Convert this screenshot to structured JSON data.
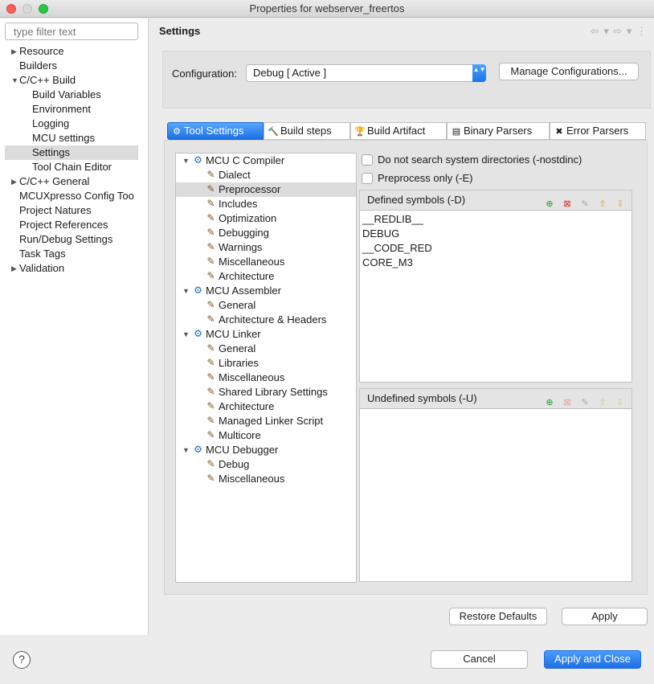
{
  "window": {
    "title": "Properties for webserver_freertos"
  },
  "sidebar": {
    "filter_placeholder": "type filter text",
    "items": [
      {
        "label": "Resource",
        "toggle": "▶",
        "child": false
      },
      {
        "label": "Builders",
        "toggle": "",
        "child": false
      },
      {
        "label": "C/C++ Build",
        "toggle": "▼",
        "child": false
      },
      {
        "label": "Build Variables",
        "toggle": "",
        "child": true
      },
      {
        "label": "Environment",
        "toggle": "",
        "child": true
      },
      {
        "label": "Logging",
        "toggle": "",
        "child": true
      },
      {
        "label": "MCU settings",
        "toggle": "",
        "child": true
      },
      {
        "label": "Settings",
        "toggle": "",
        "child": true,
        "selected": true
      },
      {
        "label": "Tool Chain Editor",
        "toggle": "",
        "child": true
      },
      {
        "label": "C/C++ General",
        "toggle": "▶",
        "child": false
      },
      {
        "label": "MCUXpresso Config Too",
        "toggle": "",
        "child": false
      },
      {
        "label": "Project Natures",
        "toggle": "",
        "child": false
      },
      {
        "label": "Project References",
        "toggle": "",
        "child": false
      },
      {
        "label": "Run/Debug Settings",
        "toggle": "",
        "child": false
      },
      {
        "label": "Task Tags",
        "toggle": "",
        "child": false
      },
      {
        "label": "Validation",
        "toggle": "▶",
        "child": false
      }
    ]
  },
  "main": {
    "title": "Settings",
    "history_nav": "⇦ ▾ ⇨ ▾ ⋮",
    "configuration": {
      "label": "Configuration:",
      "value": "Debug  [ Active ]",
      "arrow": "▲▼",
      "manage_label": "Manage Configurations..."
    },
    "tabs": [
      {
        "label": "Tool Settings",
        "icon": "⚙",
        "active": true
      },
      {
        "label": "Build steps",
        "icon": "🔨",
        "active": false
      },
      {
        "label": "Build Artifact",
        "icon": "🏆",
        "active": false
      },
      {
        "label": "Binary Parsers",
        "icon": "▤",
        "active": false
      },
      {
        "label": "Error Parsers",
        "icon": "✖",
        "active": false
      }
    ],
    "tree": [
      {
        "label": "MCU C Compiler",
        "root": true
      },
      {
        "label": "Dialect"
      },
      {
        "label": "Preprocessor",
        "selected": true
      },
      {
        "label": "Includes"
      },
      {
        "label": "Optimization"
      },
      {
        "label": "Debugging"
      },
      {
        "label": "Warnings"
      },
      {
        "label": "Miscellaneous"
      },
      {
        "label": "Architecture"
      },
      {
        "label": "MCU Assembler",
        "root": true
      },
      {
        "label": "General"
      },
      {
        "label": "Architecture & Headers"
      },
      {
        "label": "MCU Linker",
        "root": true
      },
      {
        "label": "General"
      },
      {
        "label": "Libraries"
      },
      {
        "label": "Miscellaneous"
      },
      {
        "label": "Shared Library Settings"
      },
      {
        "label": "Architecture"
      },
      {
        "label": "Managed Linker Script"
      },
      {
        "label": "Multicore"
      },
      {
        "label": "MCU Debugger",
        "root": true
      },
      {
        "label": "Debug"
      },
      {
        "label": "Miscellaneous"
      }
    ],
    "options": {
      "nostdinc_label": "Do not search system directories (-nostdinc)",
      "nostdinc_checked": false,
      "preprocess_label": "Preprocess only (-E)",
      "preprocess_checked": false
    },
    "defined": {
      "title": "Defined symbols (-D)",
      "symbols": [
        "__REDLIB__",
        "DEBUG",
        "__CODE_RED",
        "CORE_M3"
      ]
    },
    "undefined": {
      "title": "Undefined symbols (-U)",
      "symbols": []
    },
    "restore_defaults_label": "Restore Defaults",
    "apply_label": "Apply"
  },
  "footer": {
    "help": "?",
    "cancel_label": "Cancel",
    "apply_close_label": "Apply and Close"
  },
  "colors": {
    "accent": "#1f6fe5",
    "selection": "#dcdcdc"
  }
}
